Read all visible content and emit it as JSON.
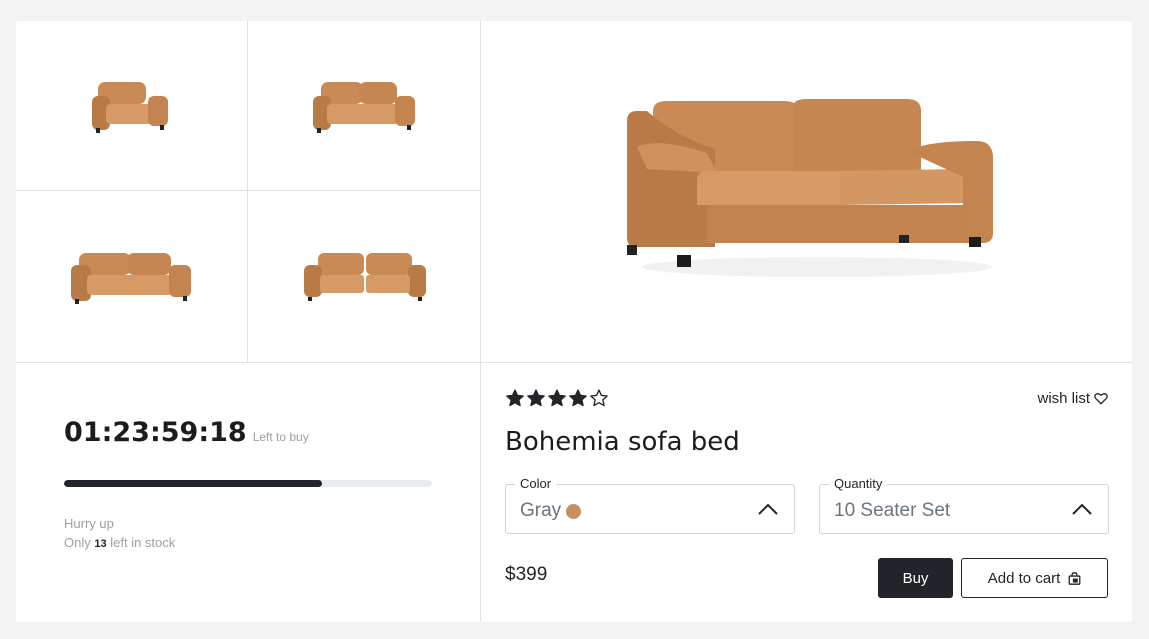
{
  "timer": {
    "value": "01:23:59:18",
    "caption": "Left to buy"
  },
  "stock": {
    "progress": 0.7,
    "hurry": "Hurry up",
    "prefix": "Only",
    "count": "13",
    "suffix": "left in stock"
  },
  "product": {
    "rating": 4,
    "rating_max": 5,
    "wishlist_label": "wish list",
    "title": "Bohemia sofa bed",
    "color": {
      "label": "Color",
      "value": "Gray",
      "swatch": "#c68f64"
    },
    "quantity": {
      "label": "Quantity",
      "value": "10 Seater Set"
    },
    "price": "$399",
    "buy_label": "Buy",
    "cart_label": "Add to cart"
  },
  "colors": {
    "sofa": "#c98a55",
    "sofa_dark": "#b07443",
    "sofa_light": "#d59a66",
    "accent": "#212529"
  },
  "icons": [
    "heart-icon",
    "shopping-bag-icon",
    "chevron-up-icon",
    "star-icon"
  ]
}
